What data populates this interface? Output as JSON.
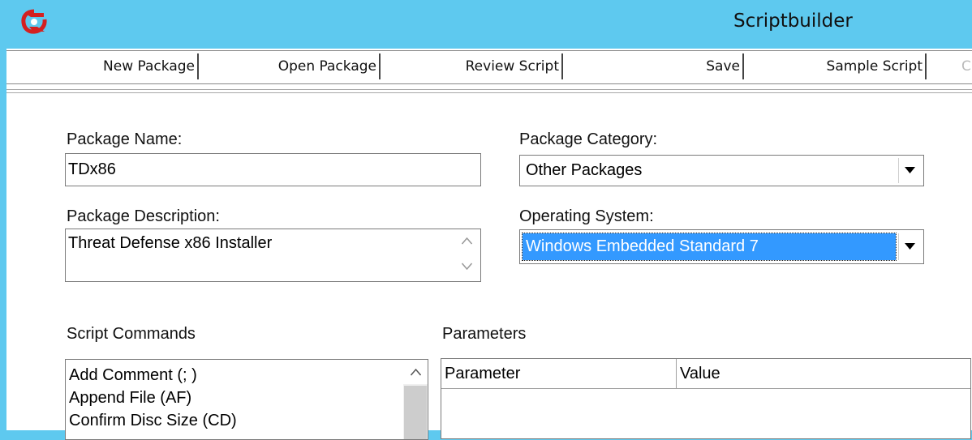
{
  "window": {
    "title": "Scriptbuilder",
    "logo_icon": "app-logo-icon",
    "logo_color": "#d42020",
    "titlebar_color": "#5ec9ef"
  },
  "toolbar": {
    "buttons": [
      {
        "label": "New Package"
      },
      {
        "label": "Open Package"
      },
      {
        "label": "Review Script"
      },
      {
        "label": "Save"
      },
      {
        "label": "Sample Script"
      }
    ],
    "overflow_label": "C"
  },
  "form": {
    "package_name": {
      "label": "Package Name:",
      "value": "TDx86"
    },
    "package_description": {
      "label": "Package Description:",
      "value": "Threat Defense x86 Installer"
    },
    "package_category": {
      "label": "Package Category:",
      "value": "Other Packages"
    },
    "operating_system": {
      "label": "Operating System:",
      "value": "Windows Embedded Standard 7"
    },
    "selection_color": "#3399ff"
  },
  "script_commands": {
    "label": "Script Commands",
    "items": [
      {
        "label": "Add Comment (; )"
      },
      {
        "label": "Append File (AF)"
      },
      {
        "label": "Confirm Disc Size (CD)"
      }
    ]
  },
  "parameters": {
    "label": "Parameters",
    "columns": [
      {
        "label": "Parameter"
      },
      {
        "label": "Value"
      }
    ]
  }
}
